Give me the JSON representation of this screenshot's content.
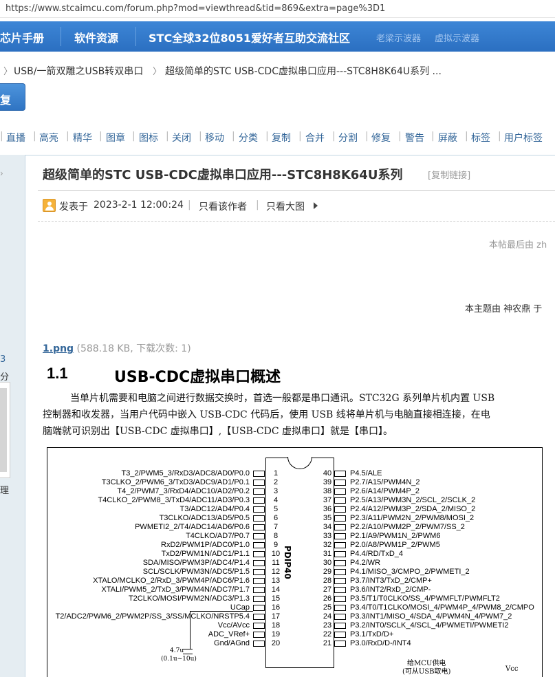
{
  "browser": {
    "url": "https://www.stcaimcu.com/forum.php?mod=viewthread&tid=869&extra=page%3D1"
  },
  "nav": {
    "items": [
      "芯片手册",
      "软件资源",
      "STC全球32位8051爱好者互助交流社区"
    ],
    "hot": [
      "老梁示波器",
      "虚拟示波器"
    ]
  },
  "breadcrumb": {
    "items": [
      "USB/一箭双雕之USB转双串口",
      "超级简单的STC USB-CDC虚拟串口应用---STC8H8K64U系列 ..."
    ]
  },
  "reply_button": "复",
  "tools": [
    "直播",
    "高亮",
    "精华",
    "图章",
    "图标",
    "关闭",
    "移动",
    "分类",
    "复制",
    "合并",
    "分割",
    "修复",
    "警告",
    "屏蔽",
    "标签",
    "用户标签"
  ],
  "sidebar": {
    "stat1": "3",
    "stat2": "分",
    "stat3": "理"
  },
  "post": {
    "title": "超级简单的STC USB-CDC虚拟串口应用---STC8H8K64U系列",
    "copy_link": "[复制链接]",
    "posted_label": "发表于",
    "posted_time": "2023-2-1 12:00:24",
    "only_author": "只看该作者",
    "only_big_image": "只看大图",
    "edit_note": "本帖最后由 zh",
    "topic_note": "本主题由 神农鼎 于",
    "attachment": {
      "name": "1.png",
      "info": "(588.18 KB, 下载次数: 1)"
    }
  },
  "doc": {
    "section_number": "1.1",
    "section_title": "USB-CDC虚拟串口概述",
    "para_lines": [
      "当单片机需要和电脑之间进行数据交换时，首选一般都是串口通讯。STC32G 系列单片机内置 USB",
      "控制器和收发器，当用户代码中嵌入 USB-CDC 代码后，使用 USB 线将单片机与电脑直接相连接，在电",
      "脑端就可识别出【USB-CDC 虚拟串口】,【USB-CDC 虚拟串口】就是【串口】。"
    ]
  },
  "chip": {
    "name": "PDIP40",
    "left_pins": [
      {
        "num": "1",
        "label": "T3_2/PWM5_3/RxD3/ADC8/AD0/P0.0"
      },
      {
        "num": "2",
        "label": "T3CLKO_2/PWM6_3/TxD3/ADC9/AD1/P0.1"
      },
      {
        "num": "3",
        "label": "T4_2/PWM7_3/RxD4/ADC10/AD2/P0.2"
      },
      {
        "num": "4",
        "label": "T4CLKO_2/PWM8_3/TxD4/ADC11/AD3/P0.3"
      },
      {
        "num": "5",
        "label": "T3/ADC12/AD4/P0.4"
      },
      {
        "num": "6",
        "label": "T3CLKO/ADC13/AD5/P0.5"
      },
      {
        "num": "7",
        "label": "PWMETI2_2/T4/ADC14/AD6/P0.6"
      },
      {
        "num": "8",
        "label": "T4CLKO/AD7/P0.7"
      },
      {
        "num": "9",
        "label": "RxD2/PWM1P/ADC0/P1.0"
      },
      {
        "num": "10",
        "label": "TxD2/PWM1N/ADC1/P1.1"
      },
      {
        "num": "11",
        "label": "SDA/MISO/PWM3P/ADC4/P1.4"
      },
      {
        "num": "12",
        "label": "SCL/SCLK/PWM3N/ADC5/P1.5"
      },
      {
        "num": "13",
        "label": "XTALO/MCLKO_2/RxD_3/PWM4P/ADC6/P1.6"
      },
      {
        "num": "14",
        "label": "XTALI/PWM5_2/TxD_3/PWM4N/ADC7/P1.7"
      },
      {
        "num": "15",
        "label": "T2CLKO/MOSI/PWM2N/ADC3/P1.3"
      },
      {
        "num": "16",
        "label": "UCap"
      },
      {
        "num": "17",
        "label": "T2/ADC2/PWM6_2/PWM2P/SS_3/SS/MCLKO/NRSTP5.4"
      },
      {
        "num": "18",
        "label": "Vcc/AVcc"
      },
      {
        "num": "19",
        "label": "ADC_VRef+"
      },
      {
        "num": "20",
        "label": "Gnd/AGnd"
      }
    ],
    "right_pins": [
      {
        "num": "40",
        "label": "P4.5/ALE"
      },
      {
        "num": "39",
        "label": "P2.7/A15/PWM4N_2"
      },
      {
        "num": "38",
        "label": "P2.6/A14/PWM4P_2"
      },
      {
        "num": "37",
        "label": "P2.5/A13/PWM3N_2/SCL_2/SCLK_2"
      },
      {
        "num": "36",
        "label": "P2.4/A12/PWM3P_2/SDA_2/MISO_2"
      },
      {
        "num": "35",
        "label": "P2.3/A11/PWM2N_2/PWM8/MOSI_2"
      },
      {
        "num": "34",
        "label": "P2.2/A10/PWM2P_2/PWM7/SS_2"
      },
      {
        "num": "33",
        "label": "P2.1/A9/PWM1N_2/PWM6"
      },
      {
        "num": "32",
        "label": "P2.0/A8/PWM1P_2/PWM5"
      },
      {
        "num": "31",
        "label": "P4.4/RD/TxD_4"
      },
      {
        "num": "30",
        "label": "P4.2/WR"
      },
      {
        "num": "29",
        "label": "P4.1/MISO_3/CMPO_2/PWMETI_2"
      },
      {
        "num": "28",
        "label": "P3.7/INT3/TxD_2/CMP+"
      },
      {
        "num": "27",
        "label": "P3.6/INT2/RxD_2/CMP-"
      },
      {
        "num": "26",
        "label": "P3.5/T1/T0CLKO/SS_4/PWMFLT/PWMFLT2"
      },
      {
        "num": "25",
        "label": "P3.4/T0/T1CLKO/MOSI_4/PWM4P_4/PWM8_2/CMPO"
      },
      {
        "num": "24",
        "label": "P3.3/INT1/MISO_4/SDA_4/PWM4N_4/PWM7_2"
      },
      {
        "num": "23",
        "label": "P3.2/INT0/SCLK_4/SCL_4/PWMETI/PWMETI2"
      },
      {
        "num": "22",
        "label": "P3.1/TxD/D+"
      },
      {
        "num": "21",
        "label": "P3.0/RxD/D-/INT4"
      }
    ],
    "cap_value": "4.7u",
    "cap_range": "(0.1u~10u)",
    "power_note_1": "给MCU供电",
    "power_note_2": "(可从USB取电)",
    "vcc_label": "Vcc"
  }
}
